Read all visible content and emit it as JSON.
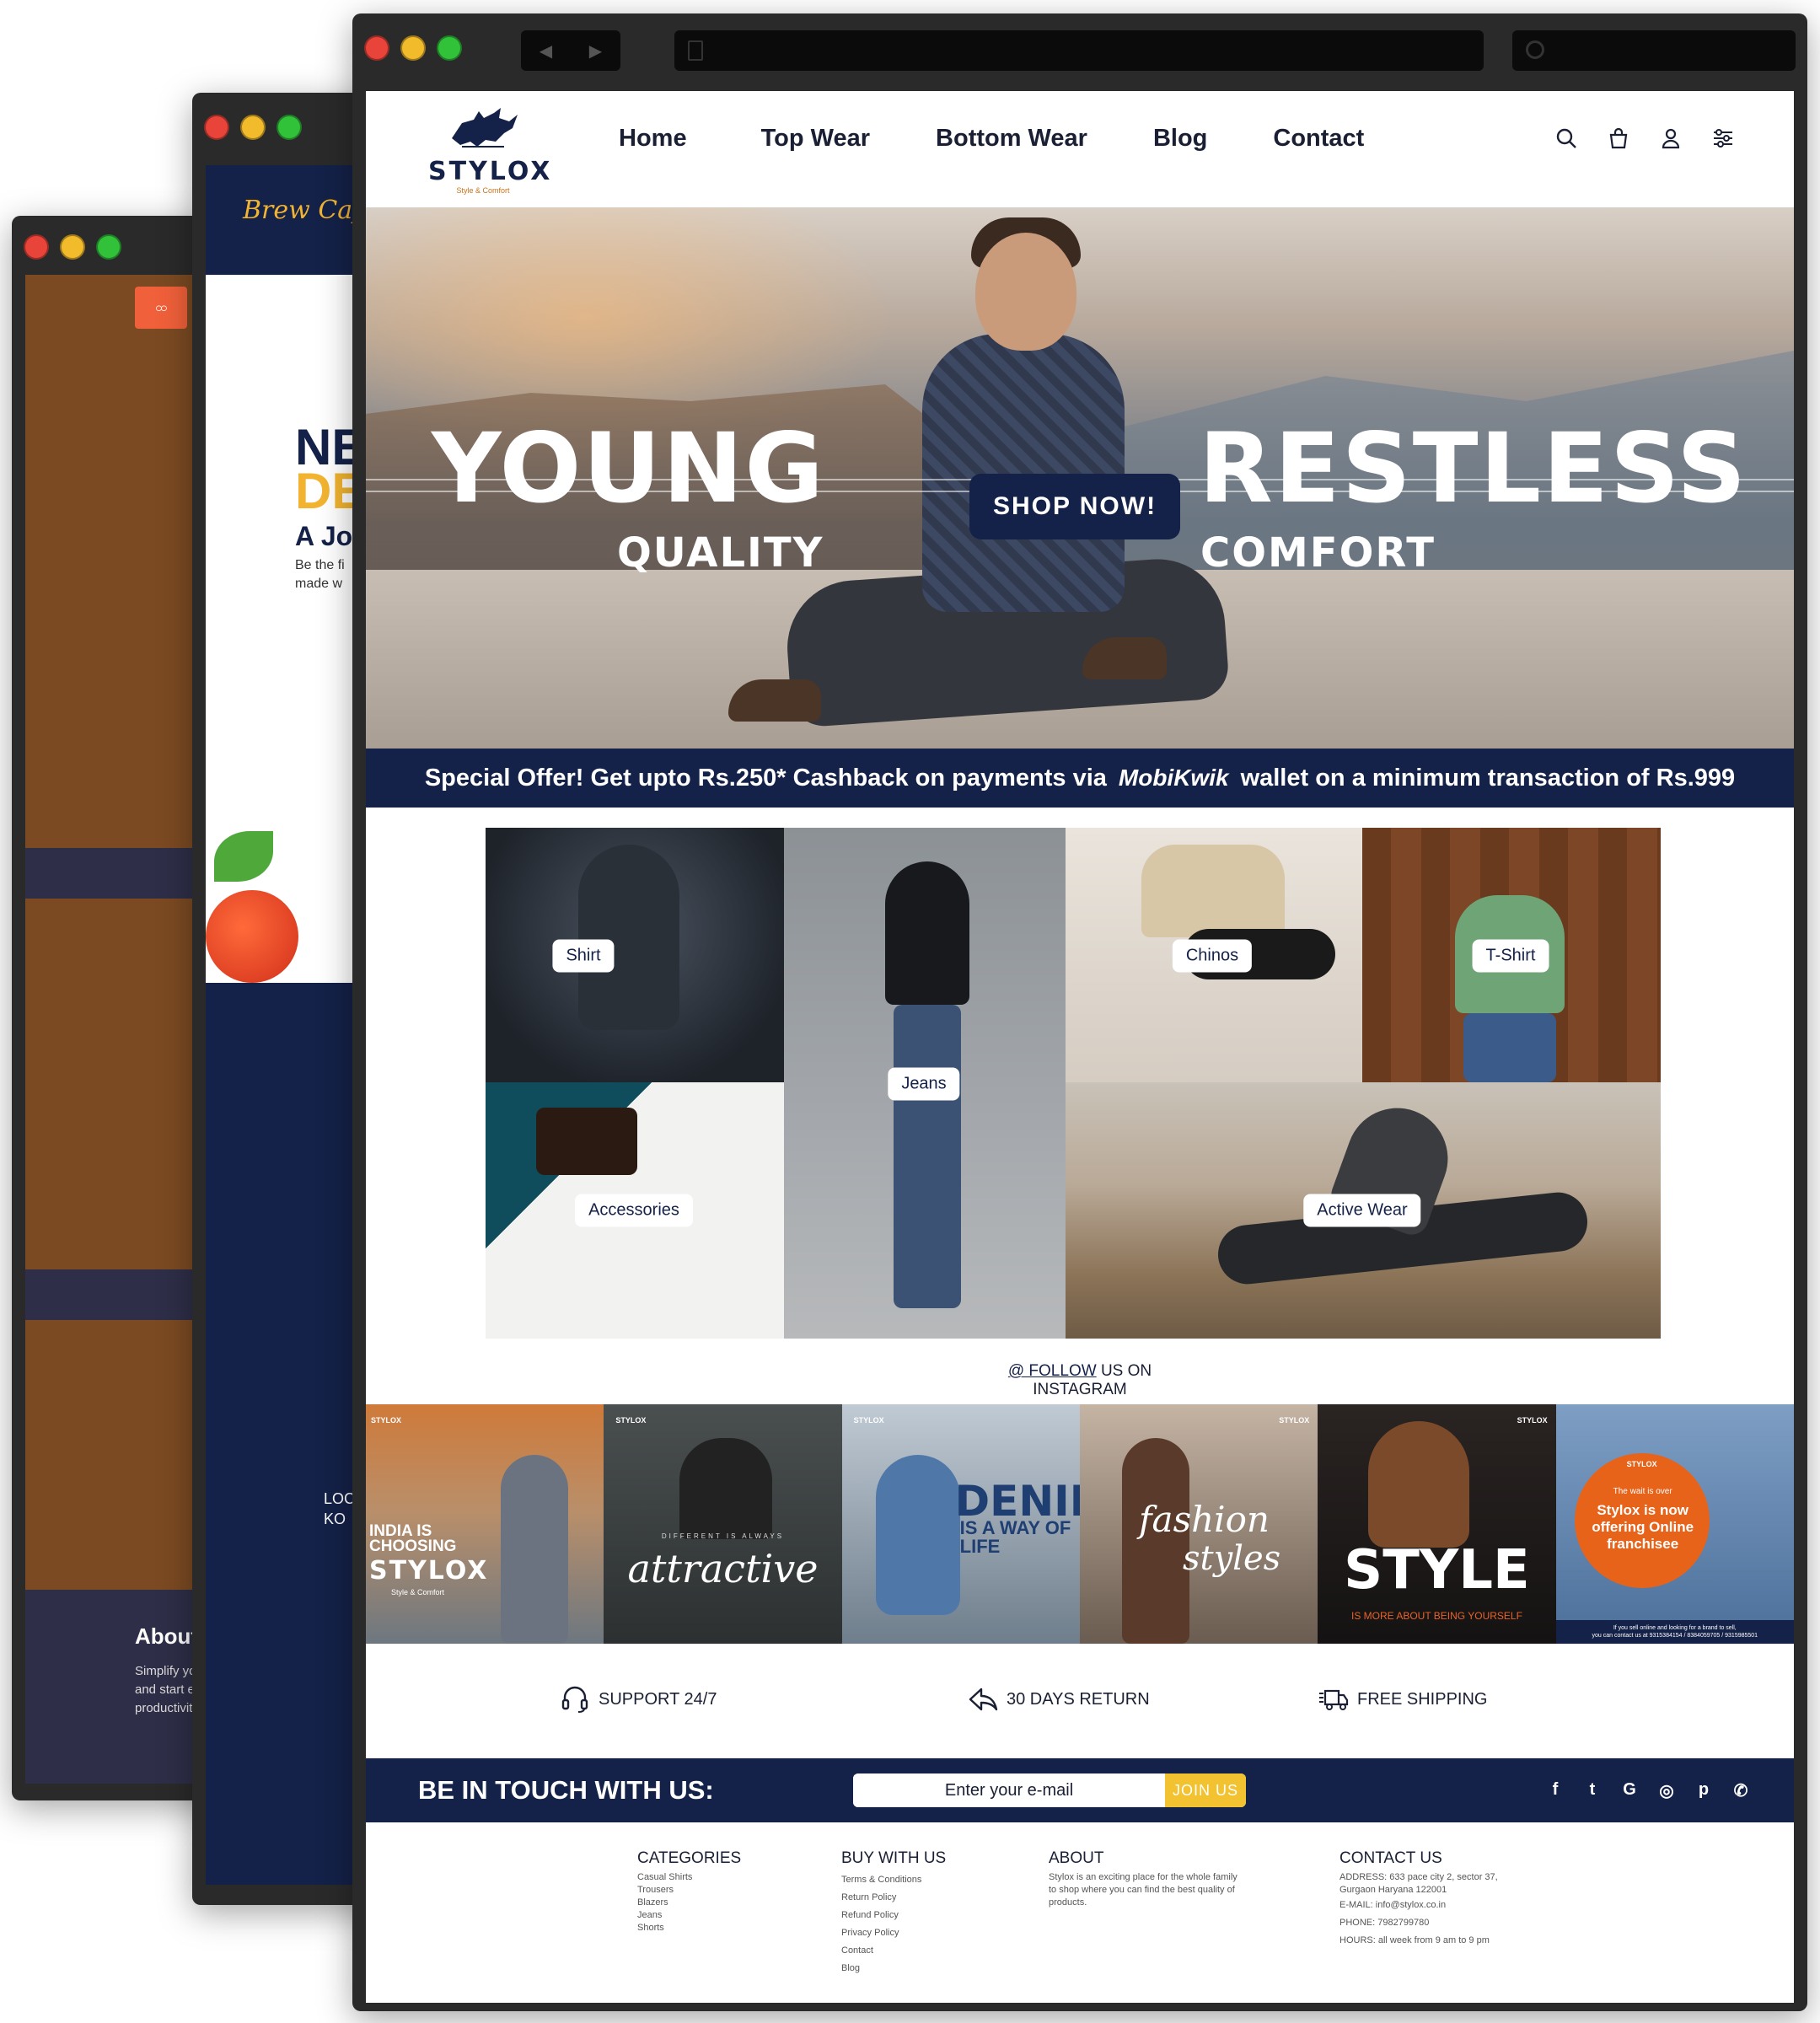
{
  "window3": {
    "logo_text": "ထ",
    "about_title": "About",
    "about_text": "Simplify yo\nand start e\nproductivity"
  },
  "window2": {
    "brand": "Brew Cafe",
    "hero_line1": "NE",
    "hero_line2": "DE",
    "hero_line3": "A Jo",
    "hero_sub": "Be the fi\nmade w",
    "location": "LOC\nKO"
  },
  "site": {
    "brand": {
      "name": "STYLOX",
      "tagline": "Style & Comfort"
    },
    "nav": [
      {
        "label": "Home"
      },
      {
        "label": "Top Wear"
      },
      {
        "label": "Bottom Wear"
      },
      {
        "label": "Blog"
      },
      {
        "label": "Contact"
      }
    ],
    "nav_icons": [
      "search-icon",
      "bag-icon",
      "user-icon",
      "filter-icon"
    ],
    "hero": {
      "word_left": "YOUNG",
      "word_right": "RESTLESS",
      "sub_left": "QUALITY",
      "sub_right": "COMFORT",
      "cta": "SHOP NOW!"
    },
    "offer": {
      "prefix": "Special Offer! Get upto Rs.250* Cashback on payments via",
      "wallet": "MobiKwik",
      "suffix": "wallet on a minimum transaction of Rs.999"
    },
    "categories": [
      {
        "label": "Shirt"
      },
      {
        "label": "Jeans"
      },
      {
        "label": "Chinos"
      },
      {
        "label": "T-Shirt"
      },
      {
        "label": "Accessories"
      },
      {
        "label": "Active Wear"
      }
    ],
    "instagram": {
      "follow_link": "@ FOLLOW",
      "follow_rest": "US ON",
      "follow_line2": "INSTAGRAM",
      "posts": [
        {
          "brand": "STYLOX",
          "line1": "INDIA IS\nCHOOSING",
          "line2": "STYLOX",
          "line3": "Style & Comfort"
        },
        {
          "brand": "STYLOX",
          "line1": "DIFFERENT IS ALWAYS",
          "line2": "attractive"
        },
        {
          "brand": "STYLOX",
          "line1": "DENIM",
          "line2": "IS A WAY OF\nLIFE"
        },
        {
          "brand": "STYLOX",
          "line1": "fashion",
          "line2": "styles"
        },
        {
          "brand": "STYLOX",
          "line1": "STYLE",
          "line2": "IS MORE ABOUT BEING YOURSELF"
        },
        {
          "brand": "STYLOX",
          "line1": "The wait is over",
          "line2": "Stylox is now\noffering Online\nfranchisee",
          "line3": "If you sell online and looking for a brand to sell,\nyou can contact us at 9315384154 / 8384059705 / 9315985501"
        }
      ]
    },
    "features": [
      {
        "icon": "headset-icon",
        "label": "SUPPORT 24/7"
      },
      {
        "icon": "return-arrow-icon",
        "label": "30 DAYS RETURN"
      },
      {
        "icon": "truck-icon",
        "label": "FREE SHIPPING"
      }
    ],
    "newsletter": {
      "title": "BE IN TOUCH WITH US:",
      "placeholder": "Enter your e-mail",
      "button": "JOIN US",
      "socials": [
        {
          "icon": "facebook-icon",
          "glyph": "f"
        },
        {
          "icon": "twitter-icon",
          "glyph": "t"
        },
        {
          "icon": "google-icon",
          "glyph": "G"
        },
        {
          "icon": "instagram-icon",
          "glyph": "◎"
        },
        {
          "icon": "pinterest-icon",
          "glyph": "p"
        },
        {
          "icon": "whatsapp-icon",
          "glyph": "✆"
        }
      ]
    },
    "footer": {
      "categories": {
        "title": "CATEGORIES",
        "items": [
          "Casual Shirts",
          "Trousers",
          "Blazers",
          "Jeans",
          "Shorts"
        ]
      },
      "buy": {
        "title": "BUY WITH US",
        "items": [
          "Terms & Conditions",
          "Return Policy",
          "Refund Policy",
          "Privacy Policy",
          "Contact",
          "Blog"
        ]
      },
      "about": {
        "title": "ABOUT",
        "text": "Stylox is an exciting place for the whole family to shop where you can find the best quality of products."
      },
      "contact": {
        "title": "CONTACT US",
        "address": "ADDRESS: 633 pace city 2, sector 37, Gurgaon Haryana 122001",
        "email": "E-MAIL: info@stylox.co.in",
        "phone": "PHONE: 7982799780",
        "hours": "HOURS: all week from 9 am to 9 pm"
      }
    },
    "colors": {
      "navy": "#142148",
      "accent": "#f2c230",
      "text": "#1a1f33"
    }
  }
}
